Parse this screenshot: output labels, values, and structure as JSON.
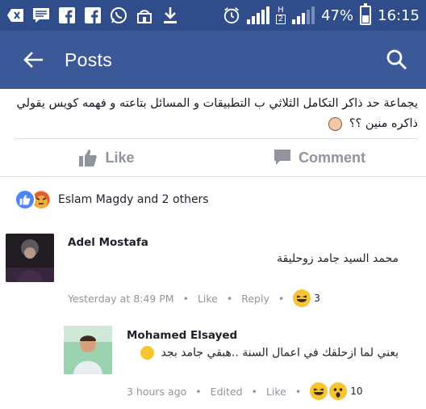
{
  "status_bar": {
    "battery": "47%",
    "time": "16:15",
    "sim2_label": "2",
    "network_h": "H"
  },
  "app_bar": {
    "title": "Posts"
  },
  "post": {
    "text_line1": "يجماعة حد ذاكر التكامل الثلاثي ب التطبيقات و المسائل بتاعته و  فهمه كويس يقولي",
    "text_line2": "ذاكره منين ؟؟"
  },
  "actions": {
    "like_label": "Like",
    "comment_label": "Comment"
  },
  "reactions": {
    "summary": "Eslam Magdy and 2 others"
  },
  "comments": [
    {
      "author": "Adel Mostafa",
      "text": "محمد السيد جامد زوحليقة",
      "time": "Yesterday at 8:49 PM",
      "like_label": "Like",
      "reply_label": "Reply",
      "reaction_count": "3"
    },
    {
      "author": "Mohamed Elsayed",
      "text": "يعني لما ازحلقك في اعمال السنة ..هبقي جامد بجد",
      "time": "3 hours ago",
      "edited_label": "Edited",
      "like_label": "Like",
      "reaction_count": "10"
    }
  ],
  "colors": {
    "status_bar": "#2f4d8a",
    "app_bar": "#3b5998",
    "like_blue": "#4f86f7",
    "muted": "#90949c"
  }
}
